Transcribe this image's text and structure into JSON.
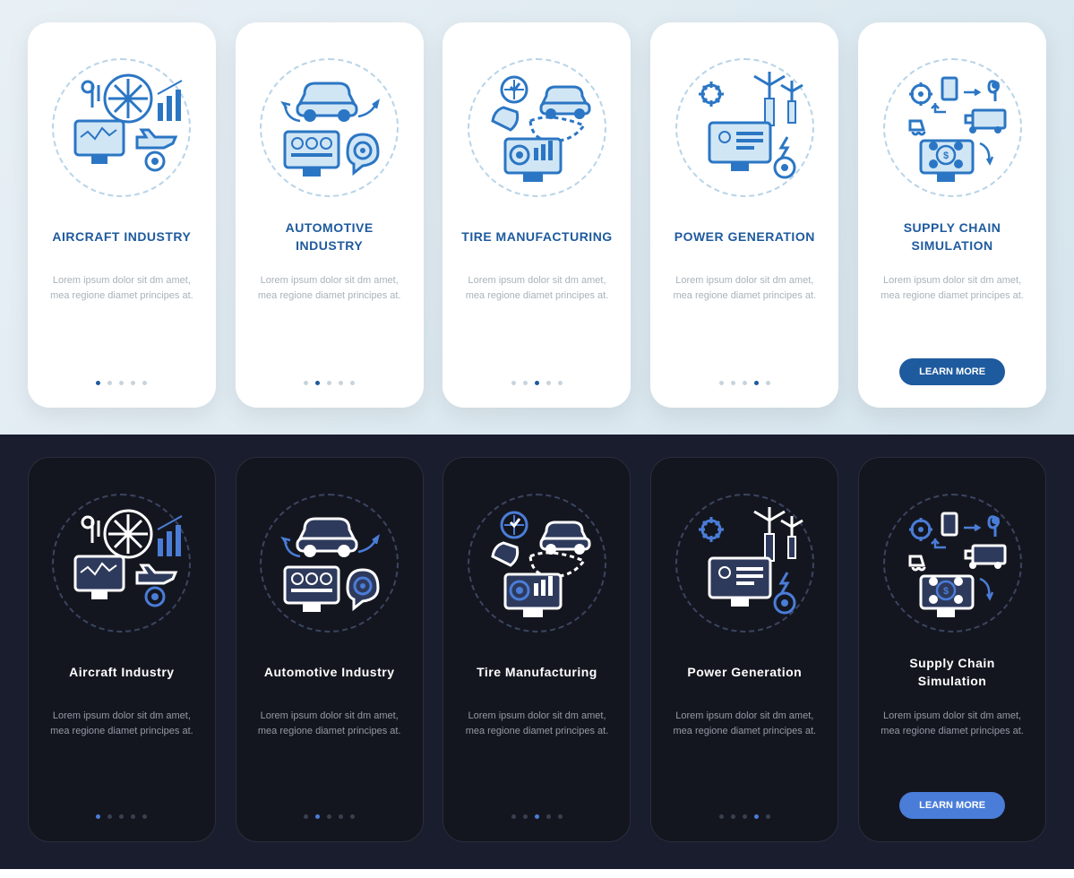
{
  "cta_label": "LEARN MORE",
  "lorem": "Lorem ipsum dolor sit dm amet, mea regione diamet principes at.",
  "light": {
    "cards": [
      {
        "title": "AIRCRAFT INDUSTRY",
        "icon": "aircraft",
        "active": 0,
        "has_cta": false
      },
      {
        "title": "AUTOMOTIVE INDUSTRY",
        "icon": "automotive",
        "active": 1,
        "has_cta": false
      },
      {
        "title": "TIRE MANUFACTURING",
        "icon": "tire",
        "active": 2,
        "has_cta": false
      },
      {
        "title": "POWER GENERATION",
        "icon": "power",
        "active": 3,
        "has_cta": false
      },
      {
        "title": "SUPPLY CHAIN SIMULATION",
        "icon": "supply",
        "active": 4,
        "has_cta": true
      }
    ]
  },
  "dark": {
    "cards": [
      {
        "title": "Aircraft Industry",
        "icon": "aircraft",
        "active": 0,
        "has_cta": false
      },
      {
        "title": "Automotive Industry",
        "icon": "automotive",
        "active": 1,
        "has_cta": false
      },
      {
        "title": "Tire Manufacturing",
        "icon": "tire",
        "active": 2,
        "has_cta": false
      },
      {
        "title": "Power Generation",
        "icon": "power",
        "active": 3,
        "has_cta": false
      },
      {
        "title": "Supply Chain Simulation",
        "icon": "supply",
        "active": 4,
        "has_cta": true
      }
    ]
  }
}
